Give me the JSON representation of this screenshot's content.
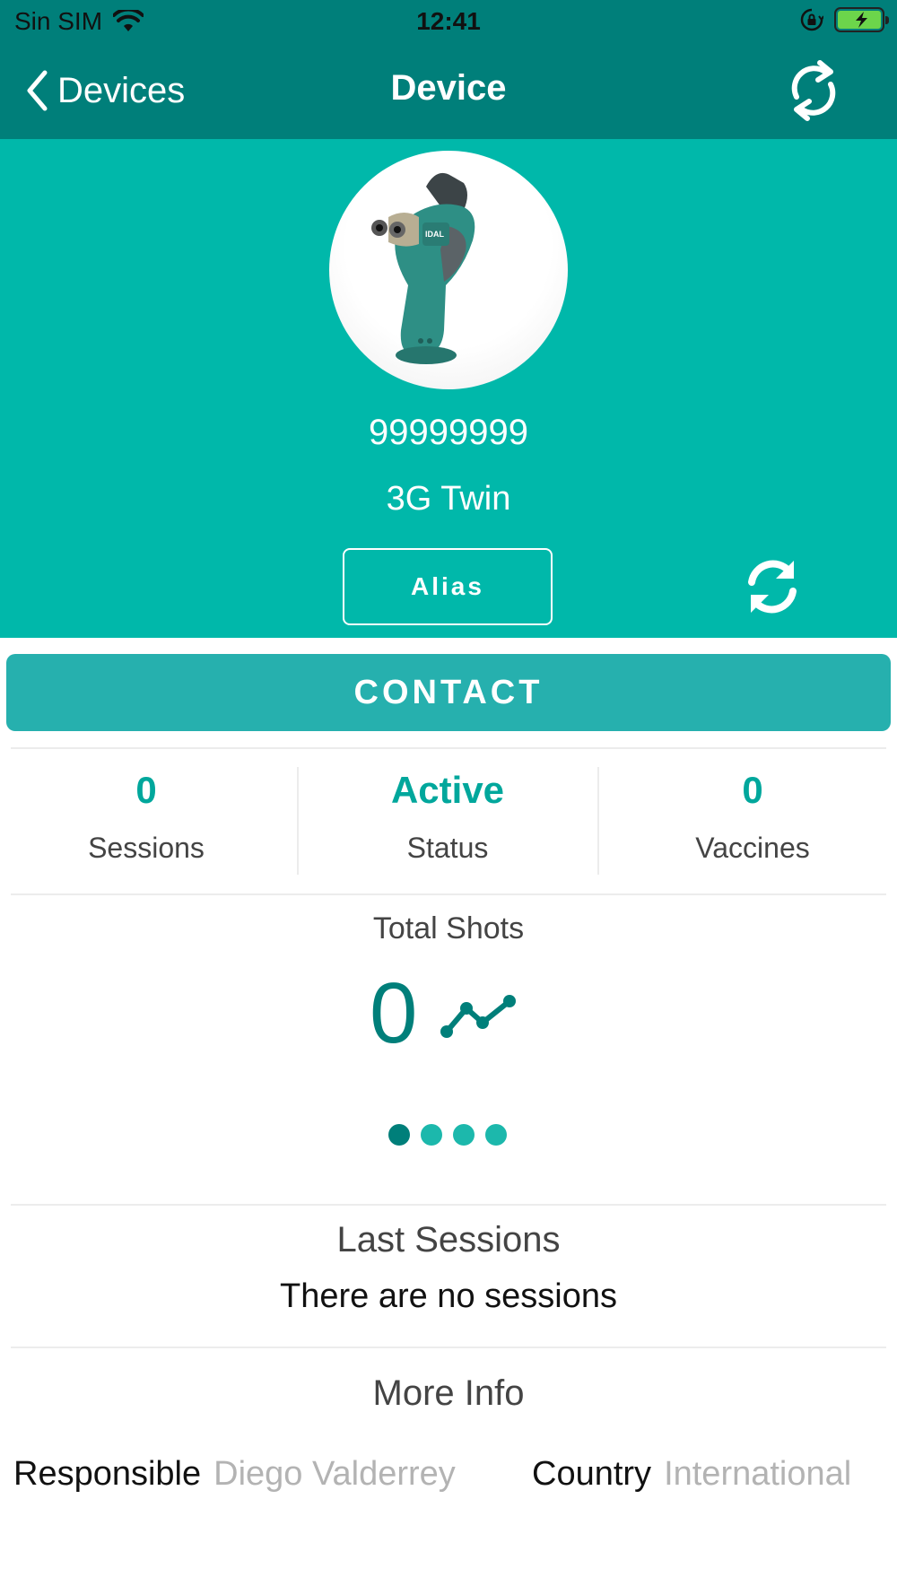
{
  "status_bar": {
    "carrier": "Sin SIM",
    "time": "12:41"
  },
  "nav": {
    "back_label": "Devices",
    "title": "Device"
  },
  "device": {
    "serial": "99999999",
    "model": "3G Twin",
    "alias_label": "Alias"
  },
  "contact_label": "CONTACT",
  "stats": [
    {
      "value": "0",
      "label": "Sessions"
    },
    {
      "value": "Active",
      "label": "Status"
    },
    {
      "value": "0",
      "label": "Vaccines"
    }
  ],
  "total_shots": {
    "title": "Total Shots",
    "value": "0",
    "page_count": 4,
    "active_page": 1
  },
  "last_sessions": {
    "title": "Last Sessions",
    "empty_text": "There are no sessions"
  },
  "more_info": {
    "title": "More Info",
    "responsible_label": "Responsible",
    "responsible_value": "Diego Valderrey",
    "country_label": "Country",
    "country_value": "International"
  },
  "colors": {
    "nav_bg": "#007f7a",
    "hero_bg": "#00b8aa",
    "contact_bg": "#26b0ae",
    "accent": "#00a79c",
    "muted_text": "#b3b3b3"
  },
  "icons": {
    "back": "chevron-left-icon",
    "refresh": "refresh-icon",
    "sync": "sync-icon",
    "trend": "trend-line-icon",
    "wifi": "wifi-icon",
    "orientation_lock": "orientation-lock-icon",
    "battery": "battery-charging-icon"
  }
}
